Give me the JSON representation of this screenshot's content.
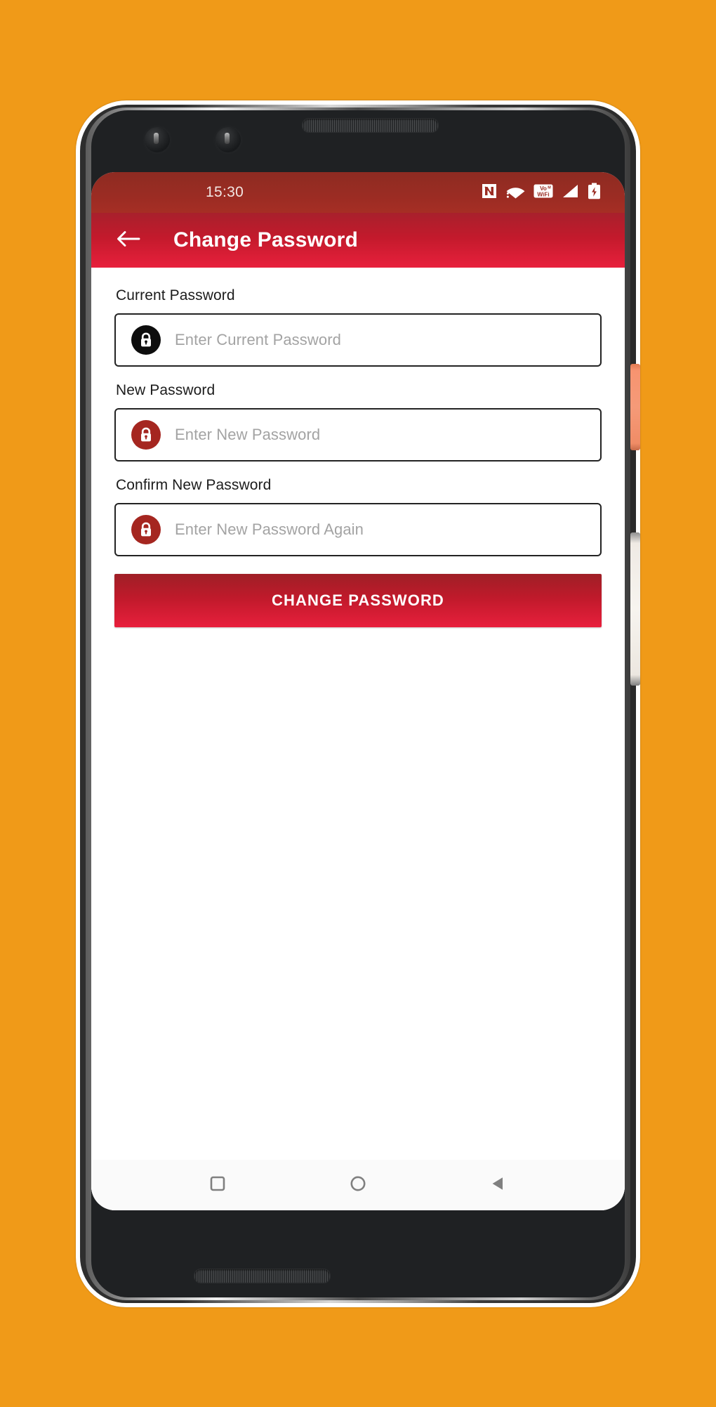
{
  "background_color": "#F09A18",
  "device": {
    "frame_name": "android-phone-mockup",
    "hardware": {
      "camera_1": "camera-lens",
      "camera_2": "camera-lens",
      "earpiece": "speaker-grille",
      "bottom_speaker": "speaker-grille",
      "power_button_color": "#F59A78",
      "volume_button_color": "#F2EEE8"
    }
  },
  "status_bar": {
    "time": "15:30",
    "background_color": "#9B2C23",
    "icons": [
      {
        "name": "nfc-icon",
        "label": "N"
      },
      {
        "name": "wifi-icon",
        "label": "WiFi"
      },
      {
        "name": "vowifi-icon",
        "label_top": "VoM",
        "label_bottom": "WiFi"
      },
      {
        "name": "cellular-signal-icon",
        "label": "Signal"
      },
      {
        "name": "battery-charging-icon",
        "label": "Battery"
      }
    ]
  },
  "app_bar": {
    "title": "Change Password",
    "back_icon": "arrow-left-icon",
    "gradient_start": "#A8202C",
    "gradient_end": "#E8203C"
  },
  "form": {
    "fields": [
      {
        "label": "Current Password",
        "placeholder": "Enter Current Password",
        "value": "",
        "icon": "lock-icon",
        "icon_bg": "#0D0D0D"
      },
      {
        "label": "New Password",
        "placeholder": "Enter New Password",
        "value": "",
        "icon": "lock-icon",
        "icon_bg": "#A52620"
      },
      {
        "label": "Confirm New Password",
        "placeholder": "Enter New Password Again",
        "value": "",
        "icon": "lock-icon",
        "icon_bg": "#A52620"
      }
    ],
    "submit_label": "CHANGE PASSWORD"
  },
  "nav_bar": {
    "buttons": [
      {
        "name": "recents-button",
        "icon": "square-icon"
      },
      {
        "name": "home-button",
        "icon": "circle-icon"
      },
      {
        "name": "back-button",
        "icon": "triangle-left-icon"
      }
    ]
  }
}
